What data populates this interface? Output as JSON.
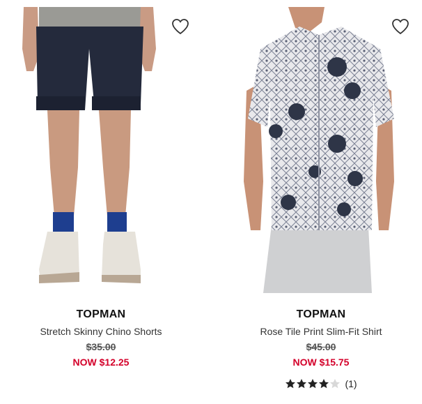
{
  "products": [
    {
      "brand": "TOPMAN",
      "name": "Stretch Skinny Chino Shorts",
      "original_price": "$35.00",
      "sale_price": "NOW $12.25",
      "image_icon": "shorts-model-photo"
    },
    {
      "brand": "TOPMAN",
      "name": "Rose Tile Print Slim-Fit Shirt",
      "original_price": "$45.00",
      "sale_price": "NOW $15.75",
      "rating": 4,
      "rating_max": 5,
      "review_count": "(1)",
      "image_icon": "shirt-model-photo"
    }
  ],
  "colors": {
    "sale": "#d4002a",
    "star_filled": "#222222",
    "star_empty": "#d8d8d8"
  }
}
